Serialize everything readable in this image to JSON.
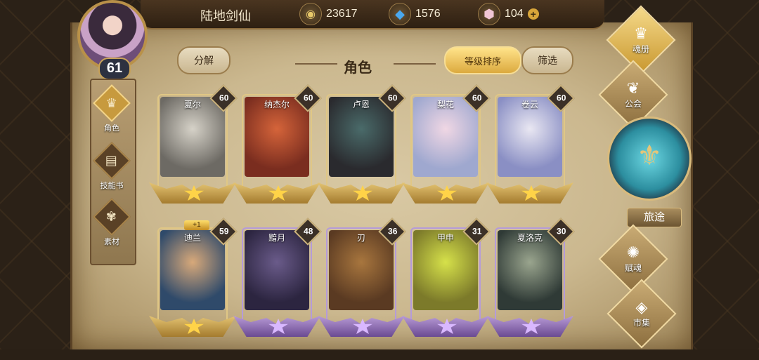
{
  "player": {
    "name": "陆地剑仙",
    "level": "61"
  },
  "resources": [
    {
      "icon": "gold-coin-icon",
      "value": "23617"
    },
    {
      "icon": "blue-crystal-icon",
      "value": "1576"
    },
    {
      "icon": "pink-gem-icon",
      "value": "104"
    }
  ],
  "left_nav": [
    {
      "label": "角色",
      "icon": "helmet-icon",
      "active": true
    },
    {
      "label": "技能书",
      "icon": "skill-book-icon",
      "active": false
    },
    {
      "label": "素材",
      "icon": "material-icon",
      "active": false
    }
  ],
  "header": {
    "dismantle": "分解",
    "title": "角色",
    "sort": "等级排序",
    "filter": "筛选"
  },
  "characters": [
    {
      "name": "夏尔",
      "level": "60",
      "tier": "gold",
      "colors": [
        "#6d6a64",
        "#d6d2c8"
      ]
    },
    {
      "name": "纳杰尔",
      "level": "60",
      "tier": "gold",
      "colors": [
        "#7a2d1f",
        "#d5643a"
      ]
    },
    {
      "name": "卢恩",
      "level": "60",
      "tier": "gold",
      "colors": [
        "#2a2a2e",
        "#4a6b6a"
      ]
    },
    {
      "name": "梨花",
      "level": "60",
      "tier": "gold",
      "colors": [
        "#9fa8cf",
        "#f0d7e4"
      ]
    },
    {
      "name": "卷云",
      "level": "60",
      "tier": "gold",
      "colors": [
        "#8a8fc4",
        "#e9e7f2"
      ]
    },
    {
      "name": "迪兰",
      "level": "59",
      "tier": "gold",
      "bonus": "+1",
      "colors": [
        "#2f4a6a",
        "#d8a97a"
      ]
    },
    {
      "name": "黯月",
      "level": "48",
      "tier": "purple",
      "colors": [
        "#2c2540",
        "#6a5b8a"
      ]
    },
    {
      "name": "刃",
      "level": "36",
      "tier": "purple",
      "colors": [
        "#5a3a22",
        "#a8763e"
      ]
    },
    {
      "name": "甲申",
      "level": "31",
      "tier": "purple",
      "colors": [
        "#7c7a2a",
        "#d6e14a"
      ]
    },
    {
      "name": "夏洛克",
      "level": "30",
      "tier": "purple",
      "colors": [
        "#2f3a36",
        "#9aa58e"
      ]
    }
  ],
  "right_nav": [
    {
      "label": "魂册",
      "icon": "soul-book-icon",
      "active": true
    },
    {
      "label": "公会",
      "icon": "guild-icon",
      "active": false
    },
    {
      "label": "旅途",
      "icon": "journey-icon",
      "active": false
    },
    {
      "label": "赋魂",
      "icon": "soul-infuse-icon",
      "active": false
    },
    {
      "label": "市集",
      "icon": "market-icon",
      "active": false
    }
  ],
  "theme": {
    "accent": "#e0b348",
    "parchment": "#d9c9a4",
    "frame": "#5b4326"
  }
}
